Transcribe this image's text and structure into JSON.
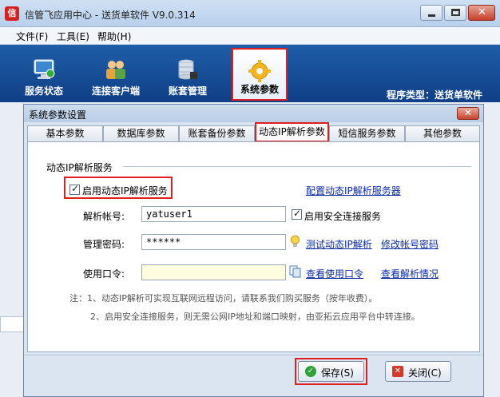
{
  "window": {
    "title": "信管飞应用中心 - 送货单软件 V9.0.314",
    "app_icon_glyph": "信",
    "menu": [
      "文件(F)",
      "工具(E)",
      "帮助(H)"
    ]
  },
  "toolbar": {
    "buttons": [
      "服务状态",
      "连接客户端",
      "账套管理",
      "系统参数"
    ],
    "program_type": "程序类型：送货单软件"
  },
  "dialog": {
    "title": "系统参数设置",
    "tabs": [
      "基本参数",
      "数据库参数",
      "账套备份参数",
      "动态IP解析参数",
      "短信服务参数",
      "其他参数"
    ],
    "active_tab": "动态IP解析参数",
    "group_title": "动态IP解析服务",
    "enable_ddns": {
      "label": "启用动态IP解析服务",
      "checked": true
    },
    "config_link": "配置动态IP解析服务器",
    "account": {
      "label": "解析帐号:",
      "value": "yatuser1"
    },
    "secure_conn": {
      "label": "启用安全连接服务",
      "checked": true
    },
    "password": {
      "label": "管理密码:",
      "value": "******"
    },
    "test_link": "测试动态IP解析",
    "change_pwd_link": "修改帐号密码",
    "token": {
      "label": "使用口令:",
      "value": ""
    },
    "view_token_link": "查看使用口令",
    "view_parse_link": "查看解析情况",
    "note1": "注：1、动态IP解析可实现互联网远程访问，请联系我们购买服务（按年收费）。",
    "note2": "2、启用安全连接服务，则无需公网IP地址和端口映射，由亚拓云应用平台中转连接。",
    "save_button": "保存(S)",
    "close_button": "关闭(C)"
  },
  "colors": {
    "toolbar_bg": "#1f5ea8",
    "highlight_red": "#e02020",
    "link_blue": "#0b2aa8"
  }
}
